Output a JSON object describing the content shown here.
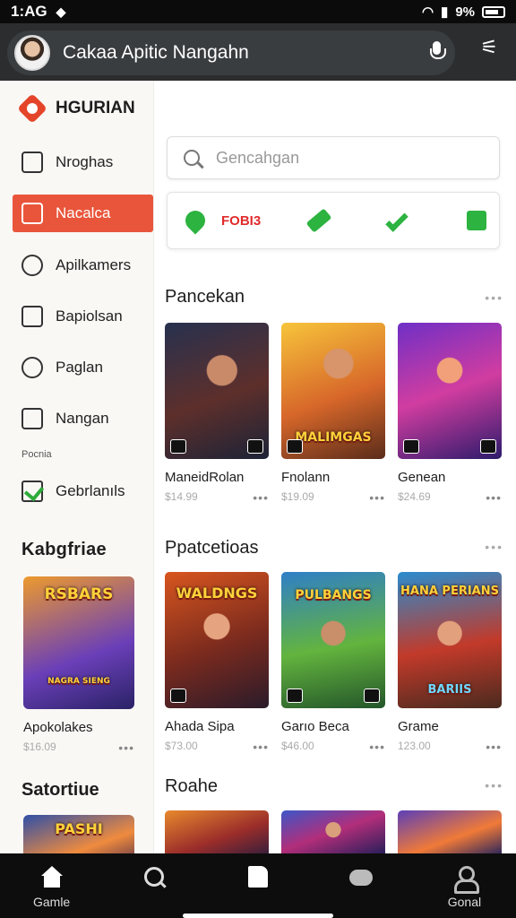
{
  "status": {
    "time": "1:AG",
    "battery": "9%"
  },
  "header": {
    "title": "Cakaa Apitic Nangahn"
  },
  "sidebar": {
    "brand": "HGURIAN",
    "items": [
      {
        "label": "Nroghas"
      },
      {
        "label": "Nacalca",
        "active": true
      },
      {
        "label": "Apilkamers"
      },
      {
        "label": "Bapiolsan"
      },
      {
        "label": "Paglan"
      },
      {
        "label": "Nangan"
      }
    ],
    "section_label": "Pocnia",
    "checked_item": "Gebrlanıls",
    "heading1": "Kabgfriae",
    "card": {
      "name": "Apokolakes",
      "price": "$16.09",
      "label_top": "RSBARS",
      "label_bottom": "NAGRA SIENG"
    },
    "heading2": "Satortiue",
    "card2_label": "PASHI"
  },
  "search": {
    "placeholder": "Gencahgan"
  },
  "quickbar": {
    "label": "FOBI3"
  },
  "sections": [
    {
      "title": "Pancekan",
      "more": "•••",
      "cards": [
        {
          "name": "ManeidRolan",
          "price": "$14.99",
          "label": ""
        },
        {
          "name": "Fnolann",
          "price": "$19.09",
          "label": "MALIMGAS"
        },
        {
          "name": "Genean",
          "price": "$24.69",
          "label": ""
        }
      ]
    },
    {
      "title": "Ppatcetioas",
      "more": "•••",
      "cards": [
        {
          "name": "Ahada Sipa",
          "price": "$73.00",
          "label": "WALDNGS"
        },
        {
          "name": "Garıo Beca",
          "price": "$46.00",
          "label": "PULBANGS"
        },
        {
          "name": "Grame",
          "price": "123.00",
          "label": "HANA PERIANS",
          "label2": "BARIIS"
        }
      ]
    },
    {
      "title": "Roahe",
      "more": "•••"
    }
  ],
  "bottom_nav": [
    {
      "label": "Gamle",
      "icon": "home-icon"
    },
    {
      "label": "",
      "icon": "search-icon"
    },
    {
      "label": "",
      "icon": "document-icon"
    },
    {
      "label": "",
      "icon": "gamepad-icon"
    },
    {
      "label": "Gonal",
      "icon": "profile-icon"
    }
  ]
}
